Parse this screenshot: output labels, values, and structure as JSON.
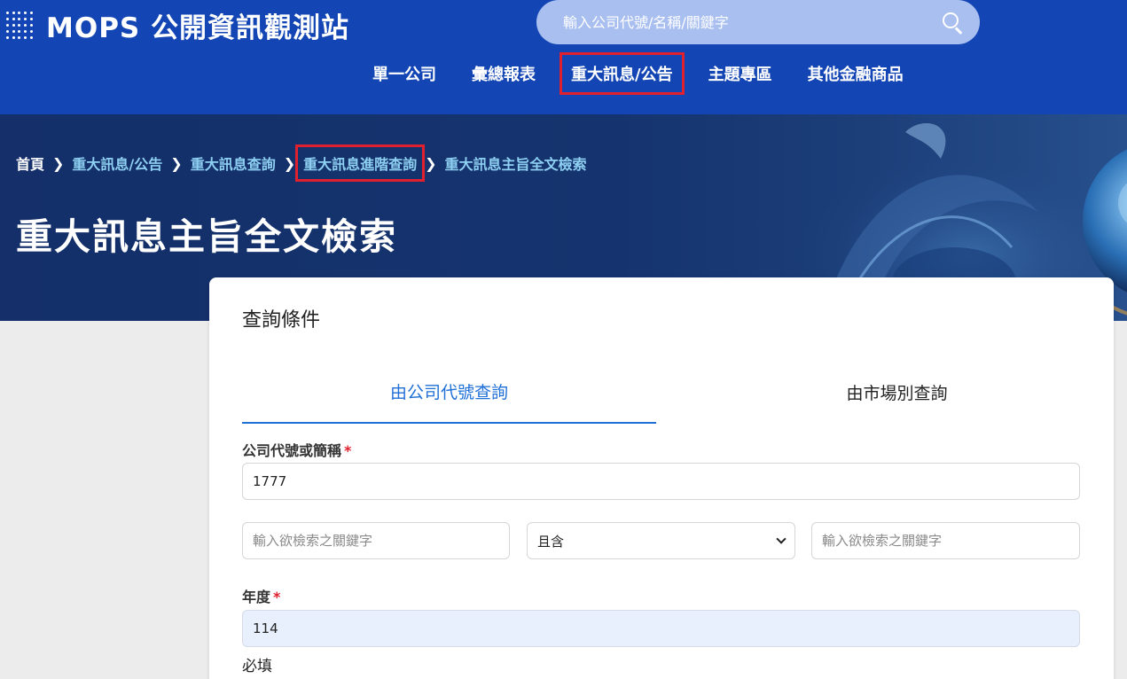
{
  "header": {
    "logo_text": "MOPS 公開資訊觀測站",
    "search_placeholder": "輸入公司代號/名稱/關鍵字",
    "nav": [
      "單一公司",
      "彙總報表",
      "重大訊息/公告",
      "主題專區",
      "其他金融商品"
    ],
    "highlight_color": "#e0202e",
    "brand_color": "#1346b4"
  },
  "breadcrumb": [
    "首頁",
    "重大訊息/公告",
    "重大訊息查詢",
    "重大訊息進階查詢",
    "重大訊息主旨全文檢索"
  ],
  "page_title": "重大訊息主旨全文檢索",
  "form": {
    "card_title": "查詢條件",
    "tabs": [
      "由公司代號查詢",
      "由市場別查詢"
    ],
    "active_tab": "由公司代號查詢",
    "company_label": "公司代號或簡稱",
    "required_mark": "*",
    "company_value": "1777",
    "keyword1_placeholder": "輸入欲檢索之關鍵字",
    "operator_value": "且含",
    "keyword2_placeholder": "輸入欲檢索之關鍵字",
    "year_label": "年度",
    "year_value": "114",
    "year_help": "必填"
  }
}
